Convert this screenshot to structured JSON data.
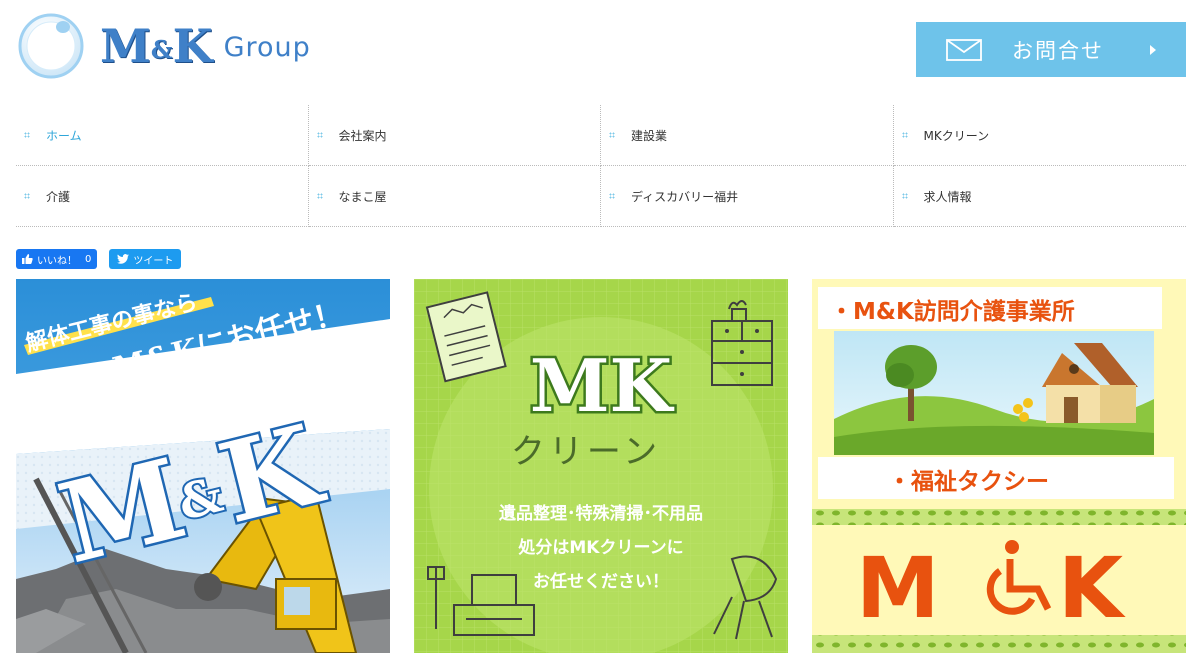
{
  "header": {
    "logo_mark_left": "M",
    "logo_mark_amp": "&",
    "logo_mark_right": "K",
    "logo_group": "Group",
    "contact_label": "お問合せ"
  },
  "nav": {
    "items": [
      {
        "label": "ホーム",
        "active": true
      },
      {
        "label": "会社案内"
      },
      {
        "label": "建設業"
      },
      {
        "label": "MKクリーン"
      },
      {
        "label": "介護"
      },
      {
        "label": "なまこ屋"
      },
      {
        "label": "ディスカバリー福井"
      },
      {
        "label": "求人情報"
      }
    ]
  },
  "social": {
    "fb_label": "いいね！",
    "fb_count": "0",
    "tw_label": "ツイート"
  },
  "cards": {
    "construction": {
      "line1": "解体工事の事なら",
      "line2": "M&Kにお任せ！",
      "logo_m": "M",
      "logo_amp": "&",
      "logo_k": "K"
    },
    "clean": {
      "logo": "MK",
      "sub": "クリーン",
      "line1": "遺品整理･特殊清掃･不用品",
      "line2": "処分はMKクリーンに",
      "line3": "お任せください！"
    },
    "care": {
      "title1": "・M&K訪問介護事業所",
      "title2": "・福祉タクシー",
      "logo_m": "M",
      "logo_k": "K"
    }
  },
  "colors": {
    "accent": "#3f80c8",
    "contact_bg": "#6ec3ea",
    "nav_active": "#2fa6d9",
    "card2_bg": "#a6d64a",
    "card3_logo": "#e8520f"
  }
}
